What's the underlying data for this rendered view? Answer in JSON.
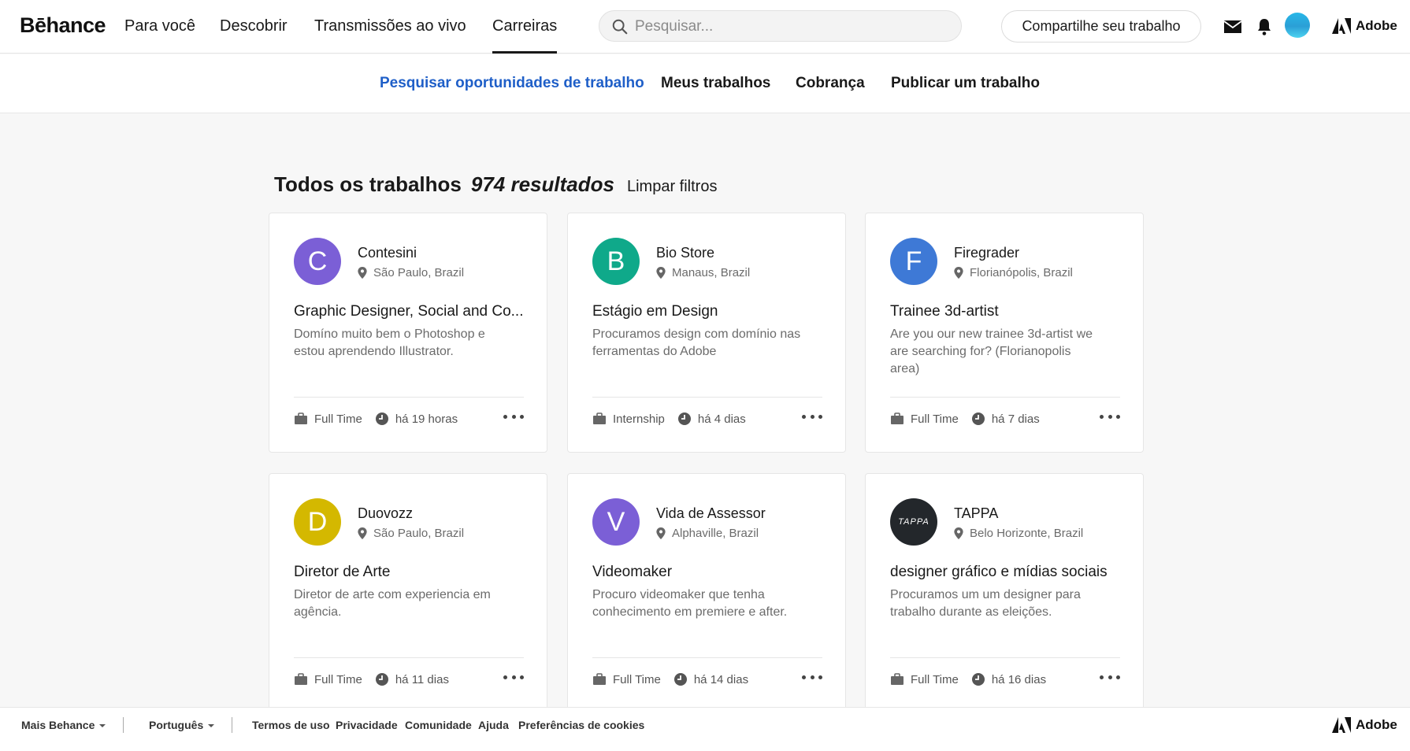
{
  "header": {
    "logo": "Bēhance",
    "nav": [
      "Para você",
      "Descobrir",
      "Transmissões ao vivo",
      "Carreiras"
    ],
    "active_nav": "Carreiras",
    "search_placeholder": "Pesquisar...",
    "share_button": "Compartilhe seu trabalho",
    "adobe_label": "Adobe",
    "icons": [
      "mail-icon",
      "bell-icon",
      "avatar",
      "adobe-logo"
    ]
  },
  "subnav": {
    "items": [
      "Pesquisar oportunidades de trabalho",
      "Meus trabalhos",
      "Cobrança",
      "Publicar um trabalho"
    ],
    "active": "Pesquisar oportunidades de trabalho",
    "active_color": "#1f5fc8"
  },
  "results": {
    "title": "Todos os trabalhos",
    "count": "974 resultados",
    "clear_filters": "Limpar filtros"
  },
  "jobs": [
    {
      "company": "Contesini",
      "initial": "C",
      "color": "#7b5fd6",
      "location": "São Paulo, Brazil",
      "title": "Graphic Designer, Social and Co...",
      "description": "Domíno muito bem o Photoshop e estou aprendendo Illustrator.",
      "type": "Full Time",
      "posted": "há 19 horas"
    },
    {
      "company": "Bio Store",
      "initial": "B",
      "color": "#0fa98a",
      "location": "Manaus, Brazil",
      "title": "Estágio em Design",
      "description": "Procuramos design com domínio nas ferramentas do Adobe",
      "type": "Internship",
      "posted": "há 4 dias"
    },
    {
      "company": "Firegrader",
      "initial": "F",
      "color": "#3e79d6",
      "location": "Florianópolis, Brazil",
      "title": "Trainee 3d-artist",
      "description": "Are you our new trainee 3d-artist we are searching for? (Florianopolis area)",
      "type": "Full Time",
      "posted": "há 7 dias"
    },
    {
      "company": "Duovozz",
      "initial": "D",
      "color": "#d4b800",
      "location": "São Paulo, Brazil",
      "title": "Diretor de Arte",
      "description": "Diretor de arte com experiencia em agência.",
      "type": "Full Time",
      "posted": "há 11 dias"
    },
    {
      "company": "Vida de Assessor",
      "initial": "V",
      "color": "#7b5fd6",
      "location": "Alphaville, Brazil",
      "title": "Videomaker",
      "description": "Procuro videomaker que tenha conhecimento em premiere e after.",
      "type": "Full Time",
      "posted": "há 14 dias"
    },
    {
      "company": "TAPPA",
      "initial": "TAPPA",
      "color": "#23272b",
      "location": "Belo Horizonte, Brazil",
      "title": "designer gráfico e mídias sociais",
      "description": "Procuramos um um designer para trabalho durante as eleições.",
      "type": "Full Time",
      "posted": "há 16 dias"
    }
  ],
  "footer": {
    "more_behance": "Mais Behance",
    "language": "Português",
    "links": [
      "Termos de uso",
      "Privacidade",
      "Comunidade",
      "Ajuda",
      "Preferências de cookies"
    ],
    "adobe_label": "Adobe"
  }
}
